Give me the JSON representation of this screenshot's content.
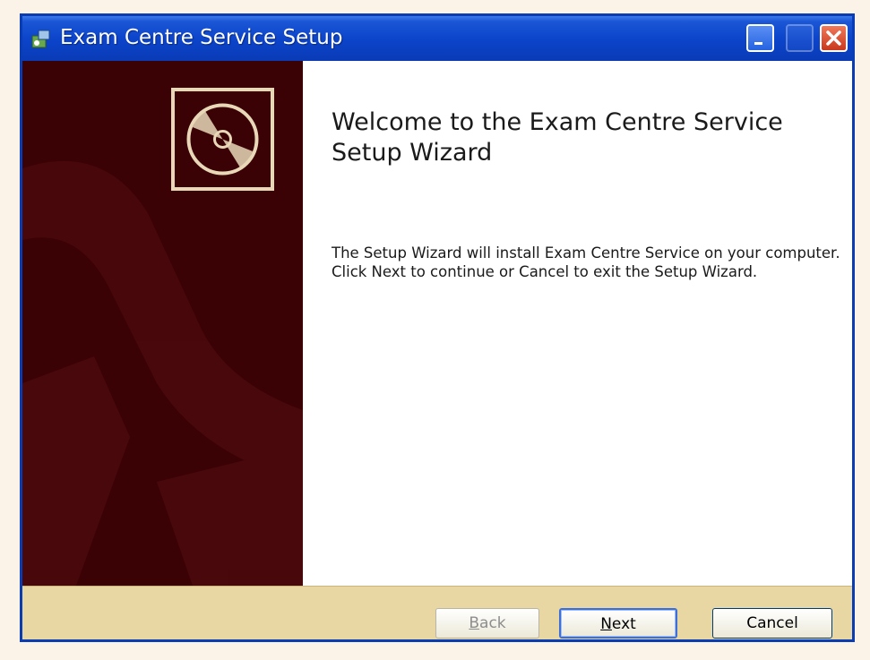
{
  "window": {
    "title": "Exam Centre Service Setup",
    "icon": "installer-icon"
  },
  "titlebar_buttons": {
    "minimize": "minimize-icon",
    "maximize": "maximize-icon",
    "close": "close-icon"
  },
  "sidebar": {
    "image": "cd-disc-icon"
  },
  "main": {
    "heading": "Welcome to the Exam Centre Service Setup Wizard",
    "description": "The Setup Wizard will install Exam Centre Service on your computer. Click Next to continue or Cancel to exit the Setup Wizard."
  },
  "buttons": {
    "back": {
      "first": "B",
      "rest": "ack",
      "enabled": false
    },
    "next": {
      "first": "N",
      "rest": "ext",
      "enabled": true
    },
    "cancel": {
      "label": "Cancel",
      "enabled": true
    }
  },
  "colors": {
    "titlebar": "#0b43c9",
    "sidebar": "#3b0206",
    "footer": "#e8d7a2"
  }
}
